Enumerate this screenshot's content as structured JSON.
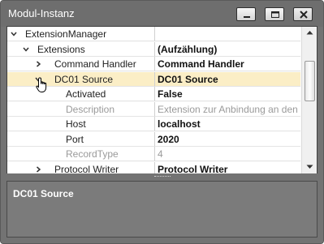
{
  "window": {
    "title": "Modul-Instanz"
  },
  "grid": {
    "rows": [
      {
        "name": "ExtensionManager",
        "value": "",
        "level": 0,
        "toggle": "down"
      },
      {
        "name": "Extensions",
        "value": "(Aufzählung)",
        "level": 1,
        "toggle": "down"
      },
      {
        "name": "Command Handler",
        "value": "Command Handler",
        "level": 2,
        "toggle": "right"
      },
      {
        "name": "DC01 Source",
        "value": "DC01 Source",
        "level": 2,
        "toggle": "down",
        "selected": true
      },
      {
        "name": "Activated",
        "value": "False",
        "level": 3
      },
      {
        "name": "Description",
        "value": "Extension zur Anbindung an den ...",
        "level": 3,
        "readonly": true
      },
      {
        "name": "Host",
        "value": "localhost",
        "level": 3
      },
      {
        "name": "Port",
        "value": "2020",
        "level": 3
      },
      {
        "name": "RecordType",
        "value": "4",
        "level": 3,
        "readonly": true
      },
      {
        "name": "Protocol Writer",
        "value": "Protocol Writer",
        "level": 2,
        "toggle": "right"
      }
    ]
  },
  "description_panel": {
    "title": "DC01 Source"
  }
}
